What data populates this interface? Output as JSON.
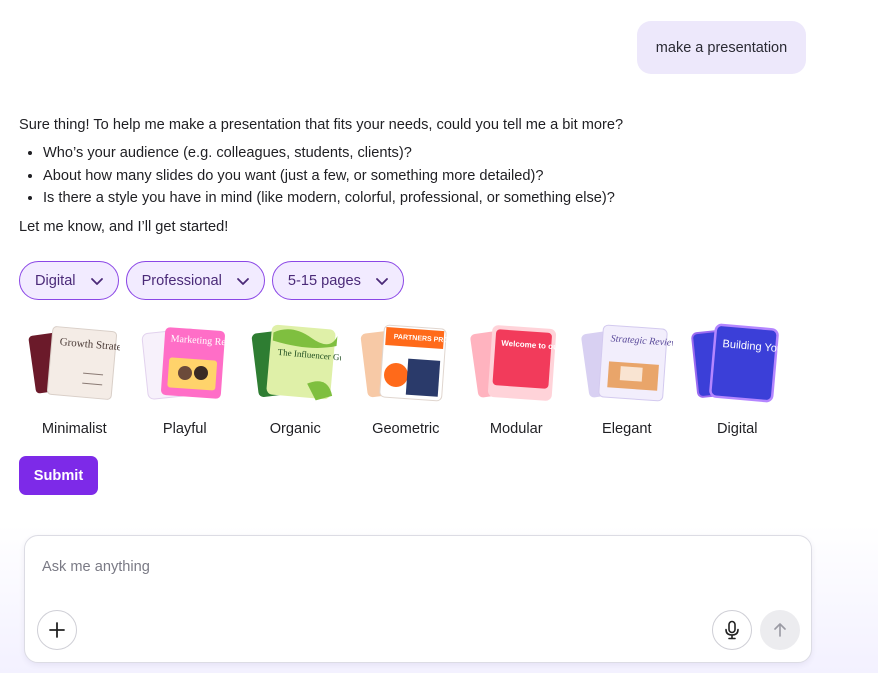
{
  "user_message": "make a presentation",
  "assistant": {
    "intro": "Sure thing! To help me make a presentation that fits your needs, could you tell me a bit more?",
    "questions": [
      "Who’s your audience (e.g. colleagues, students, clients)?",
      "About how many slides do you want (just a few, or something more detailed)?",
      "Is there a style you have in mind (like modern, colorful, professional, or something else)?"
    ],
    "outro": "Let me know, and I’ll get started!"
  },
  "chips": [
    {
      "label": "Digital",
      "icon": "chevron-down-icon"
    },
    {
      "label": "Professional",
      "icon": "chevron-down-icon"
    },
    {
      "label": "5-15 pages",
      "icon": "chevron-down-icon"
    }
  ],
  "styles": [
    {
      "label": "Minimalist",
      "thumb_text": "Growth Strategy"
    },
    {
      "label": "Playful",
      "thumb_text": "Marketing Report"
    },
    {
      "label": "Organic",
      "thumb_text": "The Influencer Guide to Branding"
    },
    {
      "label": "Geometric",
      "thumb_text": "PARTNERS PROGRAM"
    },
    {
      "label": "Modular",
      "thumb_text": "Welcome to our classroom center!"
    },
    {
      "label": "Elegant",
      "thumb_text": "Strategic Review"
    },
    {
      "label": "Digital",
      "thumb_text": "Building Your Brand"
    }
  ],
  "submit_label": "Submit",
  "composer": {
    "placeholder": "Ask me anything",
    "icons": [
      "plus-icon",
      "microphone-icon",
      "arrow-up-icon"
    ]
  },
  "colors": {
    "accent": "#7d2ae8",
    "user_bubble": "#ede8fb",
    "chip_bg": "#f2ebff",
    "chip_border": "#8b47e6"
  }
}
